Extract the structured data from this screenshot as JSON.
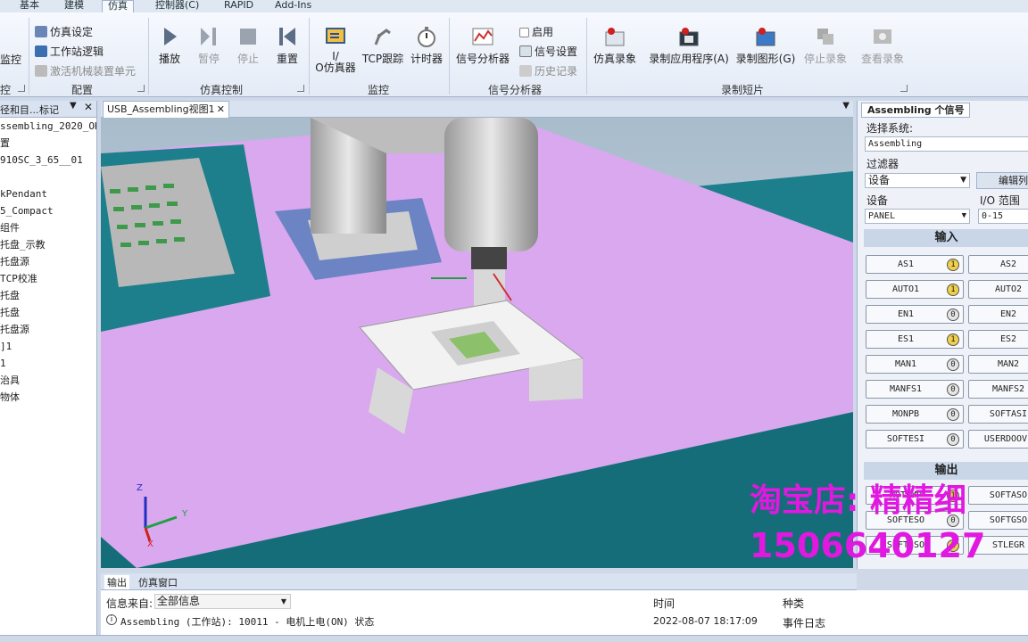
{
  "menu_tabs": [
    "基本",
    "建模",
    "仿真",
    "控制器(C)",
    "RAPID",
    "Add-Ins"
  ],
  "active_tab": "仿真",
  "ribbon": {
    "cut_monitor": "监控",
    "cut_group": "控",
    "config": {
      "sim_setup": "仿真设定",
      "station_logic": "工作站逻辑",
      "activate_unit": "激活机械装置单元",
      "label": "配置"
    },
    "sim_control": {
      "play": "播放",
      "pause": "暂停",
      "stop": "停止",
      "reset": "重置",
      "label": "仿真控制"
    },
    "monitor": {
      "io_line1": "I/",
      "io_line2": "O仿真器",
      "tcp_trace": "TCP跟踪",
      "timer": "计时器",
      "label": "监控"
    },
    "signal": {
      "analyzer": "信号分析器",
      "enable": "启用",
      "settings": "信号设置",
      "history": "历史记录",
      "label": "信号分析器"
    },
    "record": {
      "sim_record": "仿真录象",
      "record_app": "录制应用程序(A)",
      "record_graphics": "录制图形(G)",
      "stop_record": "停止录象",
      "view_record": "查看录象",
      "label": "录制短片"
    }
  },
  "left_panel": {
    "tab1": "径和目...",
    "tab2": "标记",
    "items": [
      "ssembling_2020_OK*",
      "置",
      "910SC_3_65__01",
      "",
      "kPendant",
      "5_Compact",
      "组件",
      "托盘_示教",
      "托盘源",
      "TCP校准",
      "托盘",
      "托盘",
      "托盘源",
      "]1",
      "1",
      "治具",
      "物体"
    ]
  },
  "view": {
    "tab": "USB_Assembling视图1",
    "axis_z": "Z",
    "axis_y": "Y",
    "axis_x": "X"
  },
  "io_panel": {
    "tab": "Assembling 个信号",
    "select_system_label": "选择系统:",
    "system": "Assembling",
    "filter_label": "过滤器",
    "filter_value": "设备",
    "edit_button": "编辑列",
    "device_label": "设备",
    "io_range_label": "I/O 范围",
    "device_value": "PANEL",
    "range_value": "0-15",
    "inputs_header": "输入",
    "outputs_header": "输出",
    "inputs": [
      {
        "name": "AS1",
        "on": true
      },
      {
        "name": "AS2",
        "on": false
      },
      {
        "name": "AUTO1",
        "on": true
      },
      {
        "name": "AUTO2",
        "on": false
      },
      {
        "name": "EN1",
        "on": false
      },
      {
        "name": "EN2",
        "on": false
      },
      {
        "name": "ES1",
        "on": true
      },
      {
        "name": "ES2",
        "on": false
      },
      {
        "name": "MAN1",
        "on": false
      },
      {
        "name": "MAN2",
        "on": false
      },
      {
        "name": "MANFS1",
        "on": false
      },
      {
        "name": "MANFS2",
        "on": false
      },
      {
        "name": "MONPB",
        "on": false
      },
      {
        "name": "SOFTASI",
        "on": false
      },
      {
        "name": "SOFTESI",
        "on": false
      },
      {
        "name": "USERDOOVL",
        "on": false
      }
    ],
    "outputs": [
      {
        "name": "MOTLMP",
        "on": true
      },
      {
        "name": "SOFTASO",
        "on": false
      },
      {
        "name": "SOFTESO",
        "on": false
      },
      {
        "name": "SOFTGSO",
        "on": false
      },
      {
        "name": "SOFTSSO",
        "on": true
      },
      {
        "name": "STLEGR",
        "on": false
      }
    ]
  },
  "output": {
    "tab_output": "输出",
    "tab_sim": "仿真窗口",
    "source_label": "信息来自:",
    "source_value": "全部信息",
    "col_time": "时间",
    "col_category": "种类",
    "message": "Assembling (工作站): 10011 - 电机上电(ON) 状态",
    "time": "2022-08-07 18:17:09",
    "category": "事件日志"
  },
  "watermark": {
    "shop": "淘宝店: 精精细",
    "phone": "150664012​7"
  },
  "colors": {
    "floor": "#d8a6f0",
    "conveyor": "#137a86",
    "robot": "#c8c8c8",
    "watermark": "#e018e0"
  }
}
